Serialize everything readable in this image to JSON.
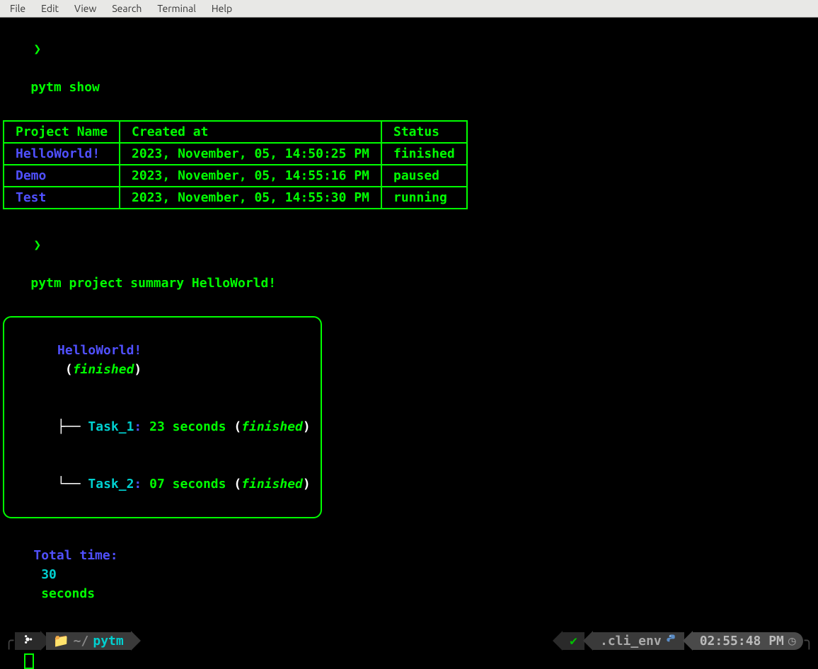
{
  "menubar": {
    "items": [
      "File",
      "Edit",
      "View",
      "Search",
      "Terminal",
      "Help"
    ]
  },
  "prompt_char": "❯",
  "commands": {
    "show": "pytm show",
    "summary": "pytm project summary HelloWorld!"
  },
  "table": {
    "headers": {
      "project": "Project Name",
      "created": "Created at",
      "status": "Status"
    },
    "rows": [
      {
        "project": "HelloWorld!",
        "created": "2023, November, 05, 14:50:25 PM",
        "status": "finished"
      },
      {
        "project": "Demo",
        "created": "2023, November, 05, 14:55:16 PM",
        "status": "paused"
      },
      {
        "project": "Test",
        "created": "2023, November, 05, 14:55:30 PM",
        "status": "running"
      }
    ]
  },
  "summary_box": {
    "project": "HelloWorld!",
    "project_status": "finished",
    "tasks": [
      {
        "tree": "├── ",
        "name": "Task_1",
        "duration": "23 seconds",
        "status": "finished"
      },
      {
        "tree": "└── ",
        "name": "Task_2",
        "duration": "07 seconds",
        "status": "finished"
      }
    ]
  },
  "total": {
    "label": "Total time",
    "value": "30",
    "unit": "seconds"
  },
  "powerline": {
    "ubuntu_icon": "ubuntu-icon",
    "path_prefix": "~/",
    "path_name": "pytm",
    "check": "✔",
    "env": ".cli_env",
    "time": "02:55:48 PM"
  },
  "chart_data": {
    "type": "table",
    "title": "pytm project list and summary",
    "columns": [
      "Project Name",
      "Created at",
      "Status"
    ],
    "rows": [
      [
        "HelloWorld!",
        "2023, November, 05, 14:50:25 PM",
        "finished"
      ],
      [
        "Demo",
        "2023, November, 05, 14:55:16 PM",
        "paused"
      ],
      [
        "Test",
        "2023, November, 05, 14:55:30 PM",
        "running"
      ]
    ],
    "summary": {
      "project": "HelloWorld!",
      "status": "finished",
      "tasks": [
        {
          "name": "Task_1",
          "seconds": 23,
          "status": "finished"
        },
        {
          "name": "Task_2",
          "seconds": 7,
          "status": "finished"
        }
      ],
      "total_seconds": 30
    }
  }
}
